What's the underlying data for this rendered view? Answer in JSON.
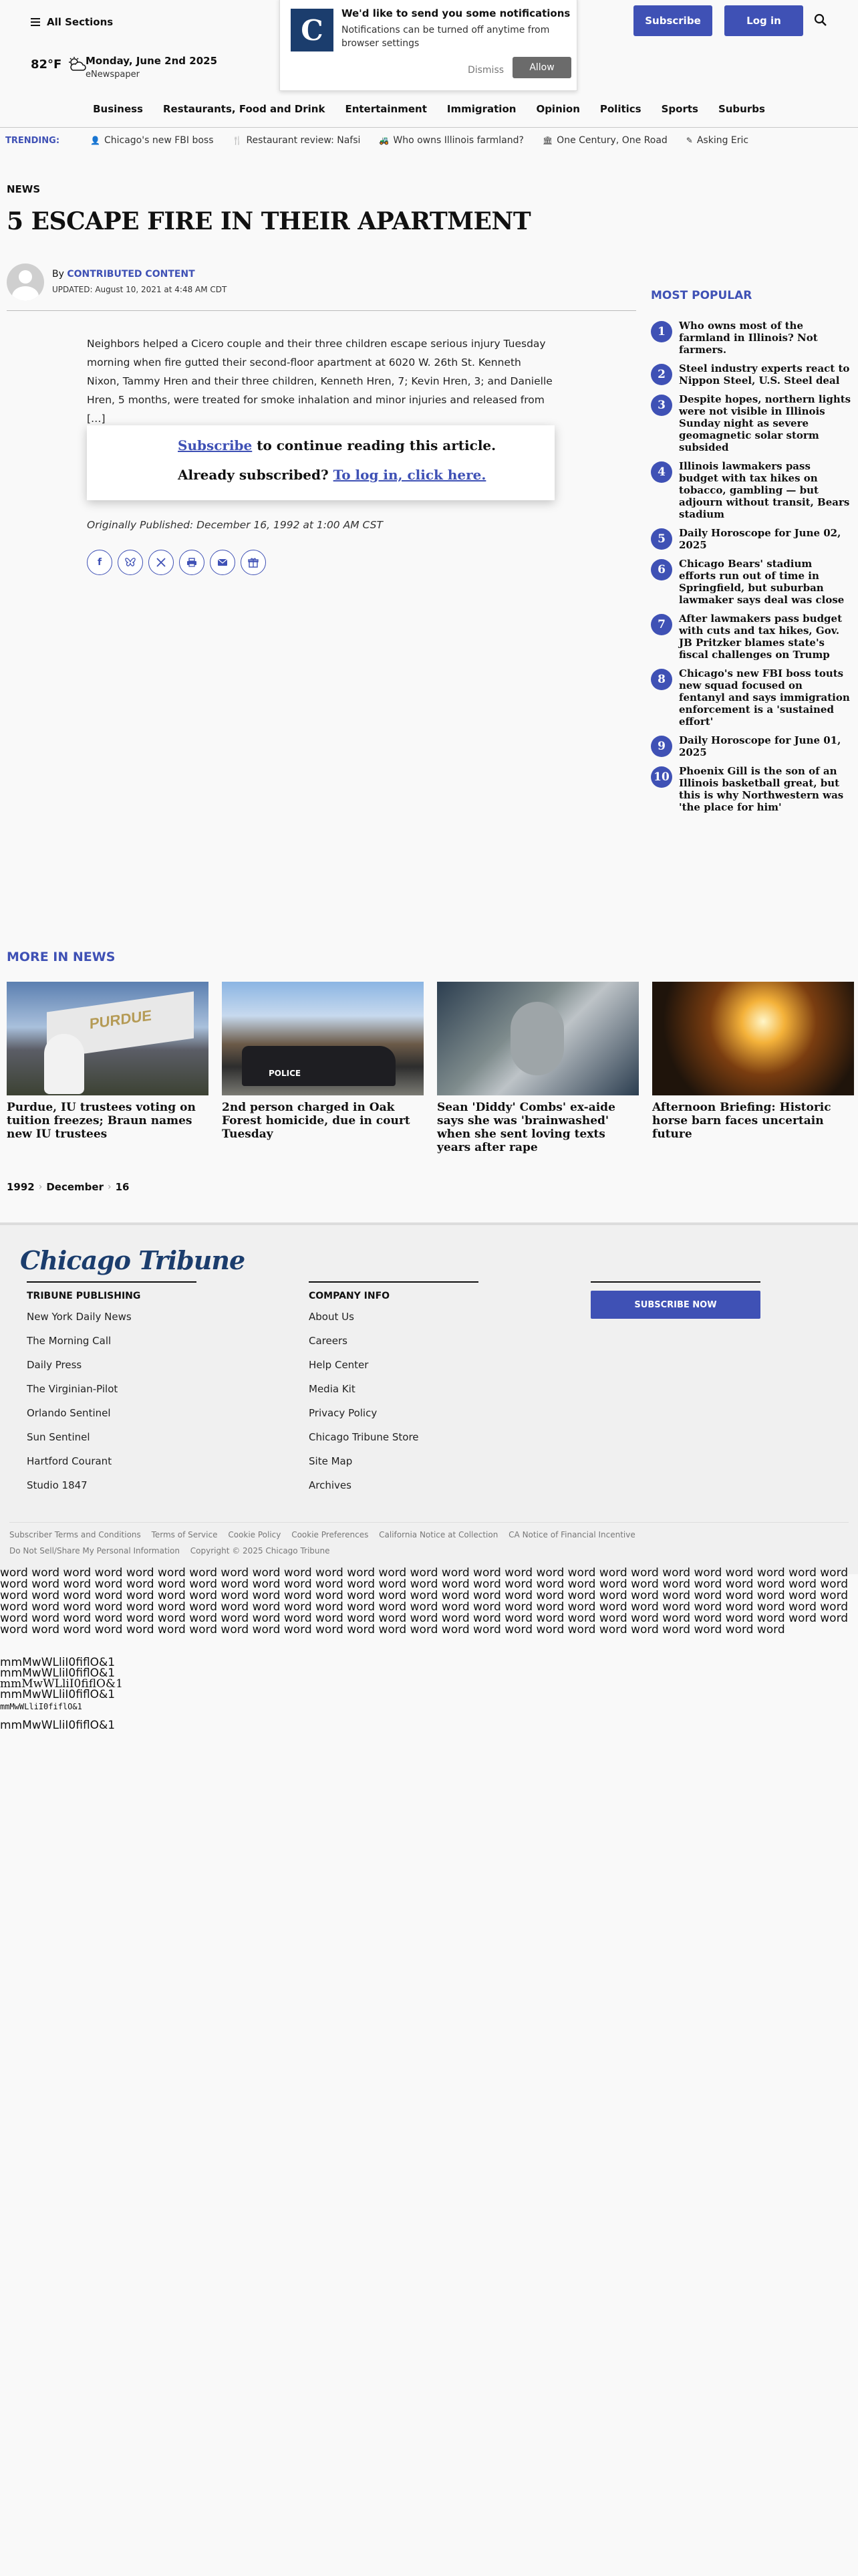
{
  "header": {
    "sections_label": "All Sections",
    "temperature": "82°F",
    "date": "Monday, June 2nd 2025",
    "enewspaper": "eNewspaper",
    "subscribe_label": "Subscribe",
    "login_label": "Log in"
  },
  "notification": {
    "logo_letter": "C",
    "title": "We'd like to send you some notifications",
    "body": "Notifications can be turned off anytime from browser settings",
    "dismiss": "Dismiss",
    "allow": "Allow"
  },
  "nav": [
    "Business",
    "Restaurants, Food and Drink",
    "Entertainment",
    "Immigration",
    "Opinion",
    "Politics",
    "Sports",
    "Suburbs"
  ],
  "trending": {
    "label": "TRENDING:",
    "items": [
      "Chicago's new FBI boss",
      "Restaurant review: Nafsi",
      "Who owns Illinois farmland?",
      "One Century, One Road",
      "Asking Eric"
    ]
  },
  "article": {
    "kicker": "NEWS",
    "headline": "5 ESCAPE FIRE IN THEIR APARTMENT",
    "by_prefix": "By",
    "author": "CONTRIBUTED CONTENT",
    "updated": "UPDATED: August 10, 2021 at 4:48 AM CDT",
    "body": "Neighbors helped a Cicero couple and their three children escape serious injury Tuesday morning when fire gutted their second-floor apartment at 6020 W. 26th St. Kenneth Nixon, Tammy Hren and their three children, Kenneth Hren, 7; Kevin Hren, 3; and Danielle Hren, 5 months, were treated for smoke inhalation and minor injuries and released from […]",
    "paywall_subscribe": "Subscribe",
    "paywall_line1_rest": " to continue reading this article.",
    "paywall_line2_prefix": "Already subscribed? ",
    "paywall_login": "To log in, click here.",
    "published": "Originally Published: December 16, 1992 at 1:00 AM CST"
  },
  "share_icons": [
    "facebook-icon",
    "bluesky-icon",
    "x-icon",
    "print-icon",
    "email-icon",
    "gift-icon"
  ],
  "most_popular": {
    "title": "MOST POPULAR",
    "items": [
      {
        "num": "1",
        "text": "Who owns most of the farmland in Illinois? Not farmers."
      },
      {
        "num": "2",
        "text": "Steel industry experts react to Nippon Steel, U.S. Steel deal"
      },
      {
        "num": "3",
        "text": "Despite hopes, northern lights were not visible in Illinois Sunday night as severe geomagnetic solar storm subsided"
      },
      {
        "num": "4",
        "text": "Illinois lawmakers pass budget with tax hikes on tobacco, gambling — but adjourn without transit, Bears stadium"
      },
      {
        "num": "5",
        "text": "Daily Horoscope for June 02, 2025"
      },
      {
        "num": "6",
        "text": "Chicago Bears' stadium efforts run out of time in Springfield, but suburban lawmaker says deal was close"
      },
      {
        "num": "7",
        "text": "After lawmakers pass budget with cuts and tax hikes, Gov. JB Pritzker blames state's fiscal challenges on Trump"
      },
      {
        "num": "8",
        "text": "Chicago's new FBI boss touts new squad focused on fentanyl and says immigration enforcement is a 'sustained effort'"
      },
      {
        "num": "9",
        "text": "Daily Horoscope for June 01, 2025"
      },
      {
        "num": "10",
        "text": "Phoenix Gill is the son of an Illinois basketball great, but this is why Northwestern was 'the place for him'"
      }
    ]
  },
  "more_in_news": {
    "title": "MORE IN NEWS",
    "cards": [
      {
        "title": "Purdue, IU trustees voting on tuition freezes; Braun names new IU trustees",
        "img_text": "PURDUE"
      },
      {
        "title": "2nd person charged in Oak Forest homicide, due in court Tuesday",
        "img_text": "POLICE"
      },
      {
        "title": "Sean 'Diddy' Combs' ex-aide says she was 'brainwashed' when she sent loving texts years after rape",
        "img_text": ""
      },
      {
        "title": "Afternoon Briefing: Historic horse barn faces uncertain future",
        "img_text": ""
      }
    ]
  },
  "breadcrumb": [
    "1992",
    "December",
    "16"
  ],
  "footer": {
    "logo": "Chicago Tribune",
    "col1_head": "TRIBUNE PUBLISHING",
    "col1_links": [
      "New York Daily News",
      "The Morning Call",
      "Daily Press",
      "The Virginian-Pilot",
      "Orlando Sentinel",
      "Sun Sentinel",
      "Hartford Courant",
      "Studio 1847"
    ],
    "col2_head": "COMPANY INFO",
    "col2_links": [
      "About Us",
      "Careers",
      "Help Center",
      "Media Kit",
      "Privacy Policy",
      "Chicago Tribune Store",
      "Site Map",
      "Archives"
    ],
    "subscribe_now": "SUBSCRIBE NOW",
    "legal_links": [
      "Subscriber Terms and Conditions",
      "Terms of Service",
      "Cookie Policy",
      "Cookie Preferences",
      "California Notice at Collection",
      "CA Notice of Financial Incentive",
      "Do Not Sell/Share My Personal Information",
      "Copyright © 2025 Chicago Tribune"
    ]
  },
  "font_test": {
    "word": "word",
    "glyph_line": "mmMwWLliI0fiflO&1"
  },
  "colors": {
    "accent": "#3f51b5",
    "brand_navy": "#1b3d6d"
  }
}
